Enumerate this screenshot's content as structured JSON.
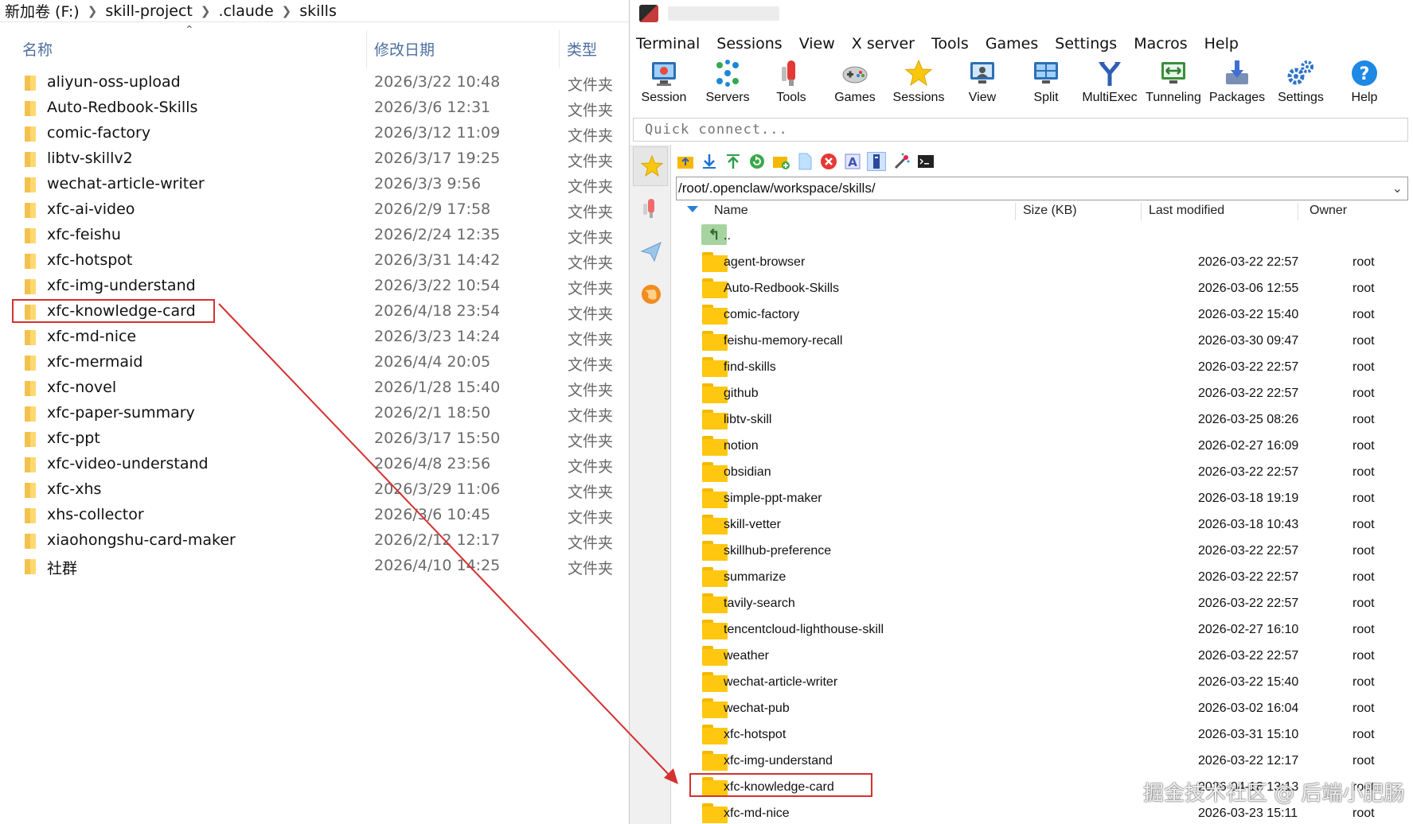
{
  "explorer": {
    "breadcrumb": [
      "新加卷 (F:)",
      "skill-project",
      ".claude",
      "skills"
    ],
    "columns": {
      "name": "名称",
      "modified": "修改日期",
      "type": "类型"
    },
    "rows": [
      {
        "name": "aliyun-oss-upload",
        "modified": "2026/3/22 10:48",
        "type": "文件夹"
      },
      {
        "name": "Auto-Redbook-Skills",
        "modified": "2026/3/6 12:31",
        "type": "文件夹"
      },
      {
        "name": "comic-factory",
        "modified": "2026/3/12 11:09",
        "type": "文件夹"
      },
      {
        "name": "libtv-skillv2",
        "modified": "2026/3/17 19:25",
        "type": "文件夹"
      },
      {
        "name": "wechat-article-writer",
        "modified": "2026/3/3 9:56",
        "type": "文件夹"
      },
      {
        "name": "xfc-ai-video",
        "modified": "2026/2/9 17:58",
        "type": "文件夹"
      },
      {
        "name": "xfc-feishu",
        "modified": "2026/2/24 12:35",
        "type": "文件夹"
      },
      {
        "name": "xfc-hotspot",
        "modified": "2026/3/31 14:42",
        "type": "文件夹"
      },
      {
        "name": "xfc-img-understand",
        "modified": "2026/3/22 10:54",
        "type": "文件夹"
      },
      {
        "name": "xfc-knowledge-card",
        "modified": "2026/4/18 23:54",
        "type": "文件夹"
      },
      {
        "name": "xfc-md-nice",
        "modified": "2026/3/23 14:24",
        "type": "文件夹"
      },
      {
        "name": "xfc-mermaid",
        "modified": "2026/4/4 20:05",
        "type": "文件夹"
      },
      {
        "name": "xfc-novel",
        "modified": "2026/1/28 15:40",
        "type": "文件夹"
      },
      {
        "name": "xfc-paper-summary",
        "modified": "2026/2/1 18:50",
        "type": "文件夹"
      },
      {
        "name": "xfc-ppt",
        "modified": "2026/3/17 15:50",
        "type": "文件夹"
      },
      {
        "name": "xfc-video-understand",
        "modified": "2026/4/8 23:56",
        "type": "文件夹"
      },
      {
        "name": "xfc-xhs",
        "modified": "2026/3/29 11:06",
        "type": "文件夹"
      },
      {
        "name": "xhs-collector",
        "modified": "2026/3/6 10:45",
        "type": "文件夹"
      },
      {
        "name": "xiaohongshu-card-maker",
        "modified": "2026/2/12 12:17",
        "type": "文件夹"
      },
      {
        "name": "社群",
        "modified": "2026/4/10 14:25",
        "type": "文件夹"
      }
    ],
    "highlighted": "xfc-knowledge-card"
  },
  "moba": {
    "menu": [
      "Terminal",
      "Sessions",
      "View",
      "X server",
      "Tools",
      "Games",
      "Settings",
      "Macros",
      "Help"
    ],
    "toolbar": [
      {
        "label": "Session",
        "icon": "monitor-icon"
      },
      {
        "label": "Servers",
        "icon": "servers-icon"
      },
      {
        "label": "Tools",
        "icon": "tools-icon"
      },
      {
        "label": "Games",
        "icon": "gamepad-icon"
      },
      {
        "label": "Sessions",
        "icon": "star-icon"
      },
      {
        "label": "View",
        "icon": "view-icon"
      },
      {
        "label": "Split",
        "icon": "split-icon"
      },
      {
        "label": "MultiExec",
        "icon": "fork-icon"
      },
      {
        "label": "Tunneling",
        "icon": "tunnel-icon"
      },
      {
        "label": "Packages",
        "icon": "package-icon"
      },
      {
        "label": "Settings",
        "icon": "gears-icon"
      },
      {
        "label": "Help",
        "icon": "help-icon"
      }
    ],
    "quick_connect_placeholder": "Quick connect...",
    "path": "/root/.openclaw/workspace/skills/",
    "columns": {
      "name": "Name",
      "size": "Size (KB)",
      "modified": "Last modified",
      "owner": "Owner"
    },
    "parent_label": "..",
    "rows": [
      {
        "name": "agent-browser",
        "modified": "2026-03-22 22:57",
        "owner": "root"
      },
      {
        "name": "Auto-Redbook-Skills",
        "modified": "2026-03-06 12:55",
        "owner": "root"
      },
      {
        "name": "comic-factory",
        "modified": "2026-03-22 15:40",
        "owner": "root"
      },
      {
        "name": "feishu-memory-recall",
        "modified": "2026-03-30 09:47",
        "owner": "root"
      },
      {
        "name": "find-skills",
        "modified": "2026-03-22 22:57",
        "owner": "root"
      },
      {
        "name": "github",
        "modified": "2026-03-22 22:57",
        "owner": "root"
      },
      {
        "name": "libtv-skill",
        "modified": "2026-03-25 08:26",
        "owner": "root"
      },
      {
        "name": "notion",
        "modified": "2026-02-27 16:09",
        "owner": "root"
      },
      {
        "name": "obsidian",
        "modified": "2026-03-22 22:57",
        "owner": "root"
      },
      {
        "name": "simple-ppt-maker",
        "modified": "2026-03-18 19:19",
        "owner": "root"
      },
      {
        "name": "skill-vetter",
        "modified": "2026-03-18 10:43",
        "owner": "root"
      },
      {
        "name": "skillhub-preference",
        "modified": "2026-03-22 22:57",
        "owner": "root"
      },
      {
        "name": "summarize",
        "modified": "2026-03-22 22:57",
        "owner": "root"
      },
      {
        "name": "tavily-search",
        "modified": "2026-03-22 22:57",
        "owner": "root"
      },
      {
        "name": "tencentcloud-lighthouse-skill",
        "modified": "2026-02-27 16:10",
        "owner": "root"
      },
      {
        "name": "weather",
        "modified": "2026-03-22 22:57",
        "owner": "root"
      },
      {
        "name": "wechat-article-writer",
        "modified": "2026-03-22 15:40",
        "owner": "root"
      },
      {
        "name": "wechat-pub",
        "modified": "2026-03-02 16:04",
        "owner": "root"
      },
      {
        "name": "xfc-hotspot",
        "modified": "2026-03-31 15:10",
        "owner": "root"
      },
      {
        "name": "xfc-img-understand",
        "modified": "2026-03-22 12:17",
        "owner": "root"
      },
      {
        "name": "xfc-knowledge-card",
        "modified": "2026-04-18 13:13",
        "owner": "root"
      },
      {
        "name": "xfc-md-nice",
        "modified": "2026-03-23 15:11",
        "owner": "root"
      }
    ],
    "highlighted": "xfc-knowledge-card"
  },
  "watermark": "掘金技术社区 @ 后端小肥肠",
  "colors": {
    "highlight": "#d63030",
    "folder": "#ffc70f",
    "accent": "#2c7fd6"
  }
}
